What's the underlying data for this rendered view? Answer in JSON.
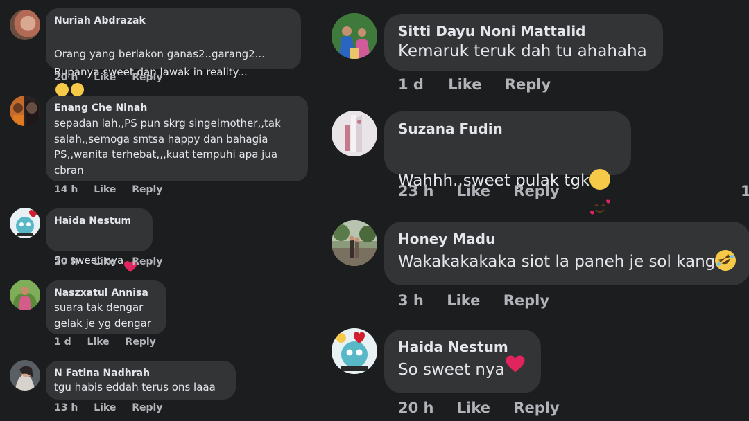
{
  "comments_left": [
    {
      "author": "Nuriah Abdrazak",
      "text": "Orang yang berlakon ganas2..garang2...\nRupanya sweet dan lawak in reality...",
      "time": "20 h",
      "like": "Like",
      "reply": "Reply",
      "emojis": [
        "grinning-sweat-emoji",
        "grinning-sweat-emoji"
      ]
    },
    {
      "author": "Enang Che Ninah",
      "text": "sepadan lah,,PS pun skrg singelmother,,tak\nsalah,,semoga smtsa happy dan bahagia\nPS,,wanita terhebat,,,kuat tempuhi apa jua\ncbran",
      "time": "14 h",
      "like": "Like",
      "reply": "Reply"
    },
    {
      "author": "Haida Nestum",
      "text": "So sweet nya",
      "time": "20 h",
      "like": "Like",
      "reply": "Reply",
      "emojis": [
        "red-heart-emoji"
      ]
    },
    {
      "author": "Naszxatul Annisa",
      "text": "suara tak dengar\ngelak je yg dengar",
      "time": "1 d",
      "like": "Like",
      "reply": "Reply"
    },
    {
      "author": "N Fatina Nadhrah",
      "text": "tgu habis eddah terus ons laaa",
      "time": "13 h",
      "like": "Like",
      "reply": "Reply"
    }
  ],
  "comments_right": [
    {
      "author": "Sitti Dayu Noni Mattalid",
      "text": "Kemaruk teruk dah tu ahahaha",
      "time": "1 d",
      "like": "Like",
      "reply": "Reply"
    },
    {
      "author": "Suzana Fudin",
      "text": "Wahhh..sweet pulak tgk",
      "time": "23 h",
      "like": "Like",
      "reply": "Reply",
      "emojis": [
        "smiling-face-with-hearts-emoji"
      ],
      "edge_count": "1"
    },
    {
      "author": "Honey Madu",
      "text": "Wakakakakaka siot la paneh je sol kang",
      "time": "3 h",
      "like": "Like",
      "reply": "Reply",
      "emojis": [
        "rolling-on-floor-laughing-emoji"
      ]
    },
    {
      "author": "Haida Nestum",
      "text": "So sweet nya",
      "time": "20 h",
      "like": "Like",
      "reply": "Reply",
      "emojis": [
        "red-heart-emoji"
      ]
    }
  ],
  "colors": {
    "background": "#1c1d1f",
    "bubble": "#333436",
    "text": "#e4e6eb",
    "meta": "#b0b3b8",
    "heart": "#e0245e",
    "emoji_yellow": "#f7c948"
  }
}
